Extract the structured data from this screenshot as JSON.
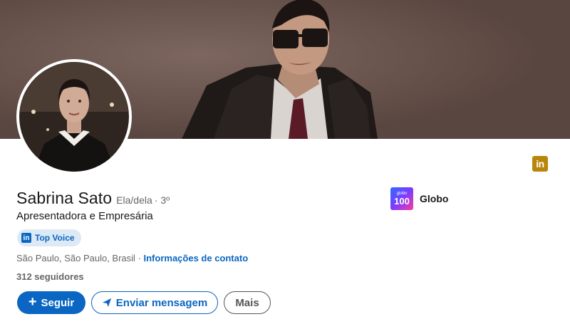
{
  "profile": {
    "name": "Sabrina Sato",
    "pronouns": "Ela/dela",
    "degree": "· 3º",
    "headline": "Apresentadora e Empresária",
    "badge_label": "Top Voice",
    "location": "São Paulo, São Paulo, Brasil",
    "location_sep": " · ",
    "contact_link": "Informações de contato",
    "followers": "312 seguidores"
  },
  "company": {
    "name": "Globo",
    "logo_text_top": "globo",
    "logo_text_main": "100"
  },
  "actions": {
    "follow_label": "Seguir",
    "message_label": "Enviar mensagem",
    "more_label": "Mais"
  },
  "icons": {
    "linkedin_corner": "linkedin-icon",
    "top_voice": "linkedin-icon",
    "follow": "plus-icon",
    "message": "send-icon"
  },
  "colors": {
    "accent": "#0a66c2",
    "badge_bg": "#dde9f5",
    "corner_badge": "#b8860b"
  }
}
